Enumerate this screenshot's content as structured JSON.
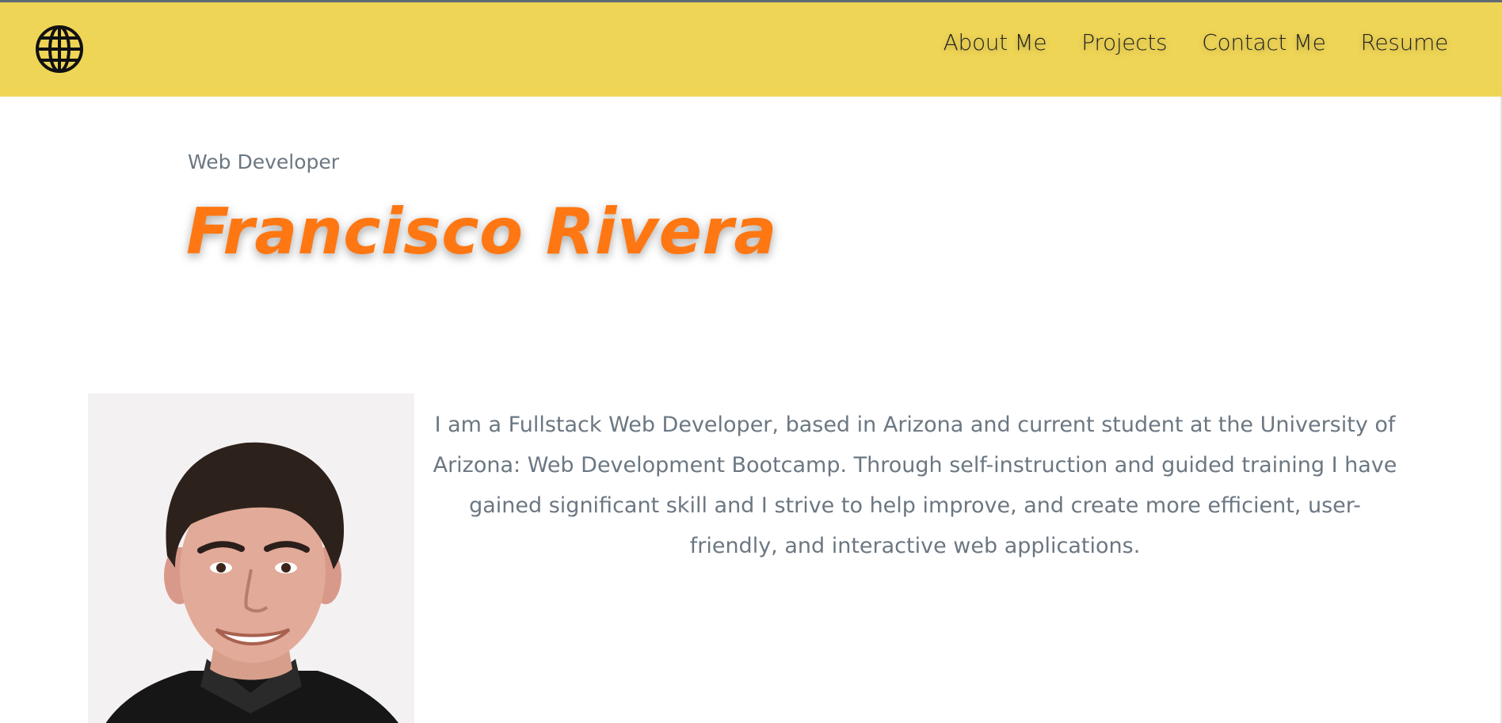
{
  "header": {
    "logo_icon": "globe-icon",
    "background_color": "#efd556",
    "nav": [
      {
        "label": "About Me"
      },
      {
        "label": "Projects"
      },
      {
        "label": "Contact Me"
      },
      {
        "label": "Resume"
      }
    ]
  },
  "hero": {
    "subtitle": "Web Developer",
    "name": "Francisco Rivera",
    "name_color": "#ff7712"
  },
  "about": {
    "photo": "profile-photo",
    "bio": "I am a Fullstack Web Developer, based in Arizona and current student at the University of Arizona: Web Development Bootcamp. Through self-instruction and guided training I have gained significant skill and I strive to help improve, and create more efficient, user-friendly, and interactive web applications."
  }
}
